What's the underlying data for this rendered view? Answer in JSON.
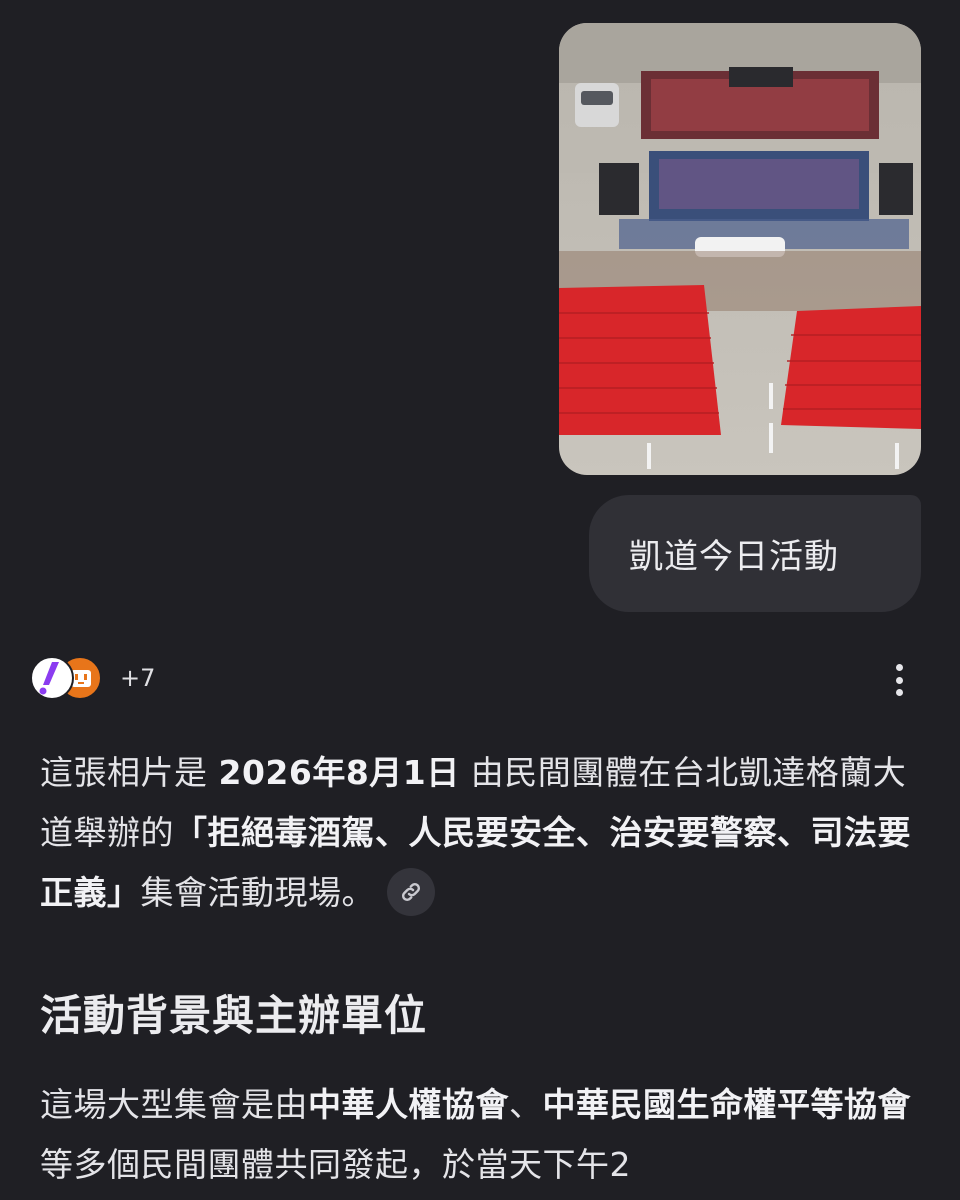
{
  "user_message": {
    "image_alt": "凱道集會照片",
    "text": "凱道今日活動"
  },
  "response": {
    "sources_more": "+7",
    "para1": {
      "s1": "這張相片是 ",
      "b1": "2026年8月1日",
      "s2": " 由民間團體在台北凱達格蘭大道舉辦的",
      "b2": "「拒絕毒酒駕、人民要安全、治安要警察、司法要正義」",
      "s3": "集會活動現場。"
    },
    "heading": "活動背景與主辦單位",
    "para2": {
      "s1": "這場大型集會是由",
      "b1": "中華人權協會",
      "s2": "、",
      "b2": "中華民國生命權平等協會",
      "s3": "等多個民間團體共同發起，於當天下午2"
    }
  },
  "icons": {
    "source1": "exclamation-logo-icon",
    "source2": "orange-face-logo-icon",
    "more": "vertical-dots-icon",
    "link": "link-icon"
  },
  "colors": {
    "background": "#1f1f24",
    "bubble": "#303036",
    "text": "#e4e4e8",
    "accent_purple": "#8b3cf0",
    "accent_orange": "#e8751a"
  }
}
